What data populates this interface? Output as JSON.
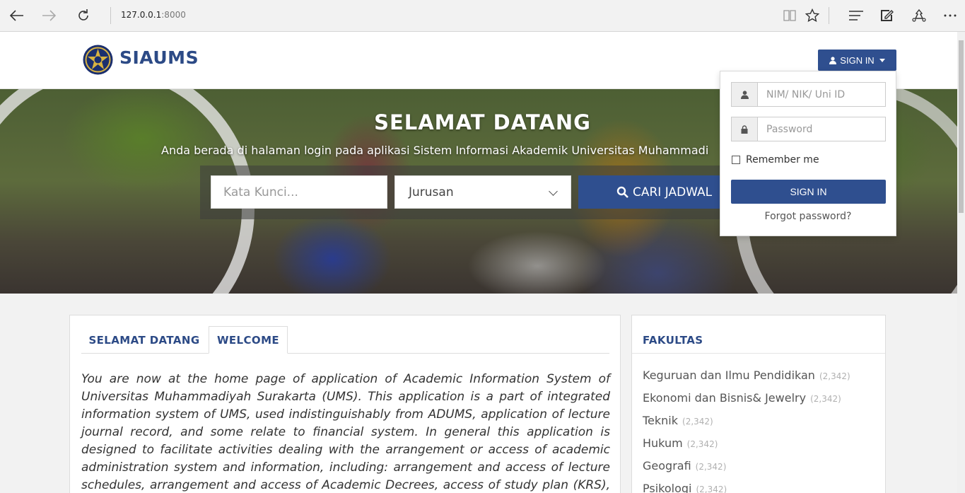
{
  "browser": {
    "url_host": "127.0.0.1",
    "url_port": ":8000"
  },
  "header": {
    "brand": "SIAUMS",
    "signin_toggle": "SIGN IN"
  },
  "hero": {
    "title": "SELAMAT DATANG",
    "subtitle": "Anda berada di halaman login pada aplikasi Sistem Informasi Akademik Universitas Muhammadi",
    "keyword_placeholder": "Kata Kunci...",
    "jurusan_selected": "Jurusan",
    "search_button": "CARI JADWAL"
  },
  "login": {
    "username_placeholder": "NIM/ NIK/ Uni ID",
    "password_placeholder": "Password",
    "remember_label": "Remember me",
    "signin_button": "SIGN IN",
    "forgot_link": "Forgot password?"
  },
  "main": {
    "tabs": [
      {
        "label": "SELAMAT DATANG"
      },
      {
        "label": "WELCOME"
      }
    ],
    "body": "You are now at the home page of application of Academic Information System of Universitas Muhammadiyah Surakarta (UMS). This application is a part of integrated information system of UMS, used indistinguishably from ADUMS, application of lecture journal record, and some relate to financial system. In general this application is designed to facilitate activities dealing with the arrangement or access of academic administration system and information, including: arrangement and access of lecture schedules, arrangement and access of Academic Decrees, access of study plan (KRS), access of exam"
  },
  "fakultas": {
    "title": "FAKULTAS",
    "items": [
      {
        "name": "Keguruan dan Ilmu Pendidikan",
        "count": "(2,342)"
      },
      {
        "name": "Ekonomi dan Bisnis& Jewelry",
        "count": "(2,342)"
      },
      {
        "name": "Teknik",
        "count": "(2,342)"
      },
      {
        "name": "Hukum",
        "count": "(2,342)"
      },
      {
        "name": "Geografi",
        "count": "(2,342)"
      },
      {
        "name": "Psikologi",
        "count": "(2,342)"
      }
    ]
  },
  "colors": {
    "brand": "#2c4a86",
    "primary_button": "#2f4f8f"
  },
  "icons": [
    "back-icon",
    "forward-icon",
    "refresh-icon",
    "reading-view-icon",
    "favorite-icon",
    "hub-icon",
    "web-note-icon",
    "share-icon",
    "more-icon",
    "user-icon",
    "lock-icon",
    "search-icon"
  ]
}
